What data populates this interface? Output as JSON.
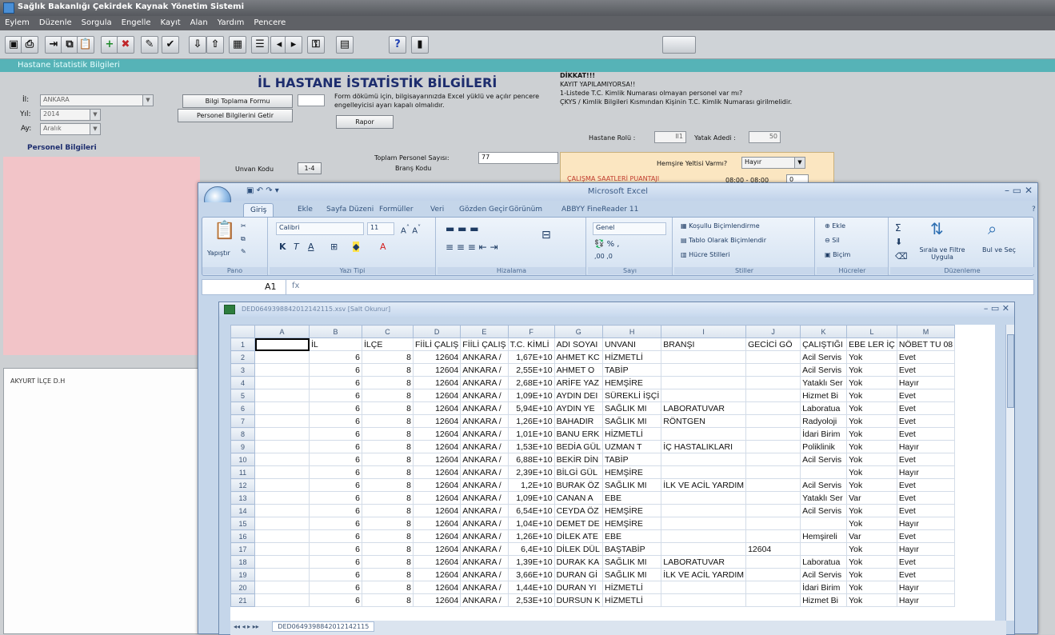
{
  "window": {
    "title": "Sağlık Bakanlığı Çekirdek Kaynak Yönetim Sistemi"
  },
  "menu": [
    "Eylem",
    "Düzenle",
    "Sorgula",
    "Engelle",
    "Kayıt",
    "Alan",
    "Yardım",
    "Pencere"
  ],
  "toolbar_icons": [
    "save-icon",
    "print-icon",
    "exit-icon",
    "copy-icon",
    "paste-icon",
    "insert-record-icon",
    "delete-record-icon",
    "edit-icon",
    "check-icon",
    "import-icon",
    "export-icon",
    "chart-icon",
    "list-icon",
    "previous-icon",
    "next-icon",
    "key-icon",
    "report-icon",
    "help-icon",
    "door-icon"
  ],
  "form": {
    "header": "Hastane İstatistik Bilgileri",
    "title": "İL HASTANE İSTATİSTİK BİLGİLERİ",
    "il_label": "İl:",
    "il_value": "ANKARA",
    "yil_label": "Yıl:",
    "yil_value": "2014",
    "ay_label": "Ay:",
    "ay_value": "Aralık",
    "btn_bilgi": "Bilgi Toplama Formu",
    "btn_personel": "Personel Bilgilerini Getir",
    "btn_rapor": "Rapor",
    "note": "Form dökümü için, bilgisayarınızda Excel yüklü ve açılır pencere engelleyicisi ayarı kapalı olmalıdır.",
    "dikkat_title": "DİKKAT!!!",
    "dikkat_lines": [
      "KAYIT YAPILAMIYORSA!!",
      "1-Listede T.C. Kimlik Numarası olmayan personel var mı?",
      "ÇKYS / Kimlik Bilgileri Kısmından Kişinin T.C. Kimlik Numarası girilmelidir."
    ],
    "hastane_rolu_label": "Hastane Rolü :",
    "hastane_rolu_value": "II1",
    "yatak_label": "Yatak Adedi :",
    "yatak_value": "50",
    "personel_section": "Personel Bilgileri",
    "unvan_label": "Unvan Kodu",
    "unvan_btn": "1-4",
    "toplam_label": "Toplam Personel Sayısı:",
    "toplam_value": "77",
    "brans_label": "Branş Kodu",
    "hemsire_label": "Hemşire Yeltisi Varmı?",
    "hemsire_value": "Hayır",
    "calisma_label": "ÇALIŞMA SAATLERİ PUANTAJI",
    "calisma_value": "08:00 - 08:00",
    "calisma_num": "0",
    "list_item": "AKYURT İLÇE D.H"
  },
  "excel": {
    "title": "Microsoft Excel",
    "tabs": [
      "Giriş",
      "Ekle",
      "Sayfa Düzeni",
      "Formüller",
      "Veri",
      "Gözden Geçir",
      "Görünüm",
      "ABBYY FineReader 11"
    ],
    "ribbon": {
      "pano": "Pano",
      "yapistir": "Yapıştır",
      "font_name": "Calibri",
      "font_size": "11",
      "yazi_tipi": "Yazı Tipi",
      "hizalama": "Hizalama",
      "genel": "Genel",
      "sayi": "Sayı",
      "kosullu": "Koşullu Biçimlendirme",
      "tablo": "Tablo Olarak Biçimlendir",
      "hucre_stil": "Hücre Stilleri",
      "stiller": "Stiller",
      "ekle": "Ekle",
      "sil": "Sil",
      "bicim": "Biçim",
      "hucreler": "Hücreler",
      "sirala": "Sırala ve Filtre Uygula",
      "bul": "Bul ve Seç",
      "duzenleme": "Düzenleme"
    },
    "name_box": "A1",
    "fx": "fx",
    "workbook_title": "DED0649398842012142115.xsv [Salt Okunur]",
    "sheet_tab": "DED0649398842012142115",
    "columns": [
      "A",
      "B",
      "C",
      "D",
      "E",
      "F",
      "G",
      "H",
      "I",
      "J",
      "K",
      "L",
      "M"
    ],
    "rows": [
      [
        "1",
        "",
        "İL",
        "İLÇE",
        "FİİLİ ÇALIŞ",
        "FİİLİ ÇALIŞ",
        "T.C. KİMLİ",
        "ADI SOYAI",
        "UNVANI",
        "BRANŞI",
        "GECİCİ GÖ",
        "ÇALIŞTIĞI",
        "EBE LER İÇ",
        "NÖBET TU 08"
      ],
      [
        "2",
        "",
        "6",
        "8",
        "12604",
        "ANKARA /",
        "1,67E+10",
        "AHMET KC",
        "HİZMETLİ",
        "",
        "",
        "Acil Servis",
        "Yok",
        "Evet"
      ],
      [
        "3",
        "",
        "6",
        "8",
        "12604",
        "ANKARA /",
        "2,55E+10",
        "AHMET O",
        "TABİP",
        "",
        "",
        "Acil Servis",
        "Yok",
        "Evet"
      ],
      [
        "4",
        "",
        "6",
        "8",
        "12604",
        "ANKARA /",
        "2,68E+10",
        "ARİFE YAZ",
        "HEMŞİRE",
        "",
        "",
        "Yataklı Ser",
        "Yok",
        "Hayır"
      ],
      [
        "5",
        "",
        "6",
        "8",
        "12604",
        "ANKARA /",
        "1,09E+10",
        "AYDIN DEI",
        "SÜREKLİ İŞÇİ",
        "",
        "",
        "Hizmet Bi",
        "Yok",
        "Evet"
      ],
      [
        "6",
        "",
        "6",
        "8",
        "12604",
        "ANKARA /",
        "5,94E+10",
        "AYDIN YE",
        "SAĞLIK MI",
        "LABORATUVAR",
        "",
        "Laboratua",
        "Yok",
        "Evet"
      ],
      [
        "7",
        "",
        "6",
        "8",
        "12604",
        "ANKARA /",
        "1,26E+10",
        "BAHADIR",
        "SAĞLIK MI",
        "RÖNTGEN",
        "",
        "Radyoloji",
        "Yok",
        "Evet"
      ],
      [
        "8",
        "",
        "6",
        "8",
        "12604",
        "ANKARA /",
        "1,01E+10",
        "BANU ERK",
        "HİZMETLİ",
        "",
        "",
        "İdari Birim",
        "Yok",
        "Evet"
      ],
      [
        "9",
        "",
        "6",
        "8",
        "12604",
        "ANKARA /",
        "1,53E+10",
        "BEDİA GÜL",
        "UZMAN T",
        "İÇ HASTALIKLARI",
        "",
        "Poliklinik",
        "Yok",
        "Hayır"
      ],
      [
        "10",
        "",
        "6",
        "8",
        "12604",
        "ANKARA /",
        "6,88E+10",
        "BEKİR DİN",
        "TABİP",
        "",
        "",
        "Acil Servis",
        "Yok",
        "Evet"
      ],
      [
        "11",
        "",
        "6",
        "8",
        "12604",
        "ANKARA /",
        "2,39E+10",
        "BİLGİ GÜL",
        "HEMŞİRE",
        "",
        "",
        "",
        "Yok",
        "Hayır"
      ],
      [
        "12",
        "",
        "6",
        "8",
        "12604",
        "ANKARA /",
        "1,2E+10",
        "BURAK ÖZ",
        "SAĞLIK MI",
        "İLK VE ACİL YARDIM",
        "",
        "Acil Servis",
        "Yok",
        "Evet"
      ],
      [
        "13",
        "",
        "6",
        "8",
        "12604",
        "ANKARA /",
        "1,09E+10",
        "CANAN A",
        "EBE",
        "",
        "",
        "Yataklı Ser",
        "Var",
        "Evet"
      ],
      [
        "14",
        "",
        "6",
        "8",
        "12604",
        "ANKARA /",
        "6,54E+10",
        "CEYDA ÖZ",
        "HEMŞİRE",
        "",
        "",
        "Acil Servis",
        "Yok",
        "Evet"
      ],
      [
        "15",
        "",
        "6",
        "8",
        "12604",
        "ANKARA /",
        "1,04E+10",
        "DEMET DE",
        "HEMŞİRE",
        "",
        "",
        "",
        "Yok",
        "Hayır"
      ],
      [
        "16",
        "",
        "6",
        "8",
        "12604",
        "ANKARA /",
        "1,26E+10",
        "DİLEK ATE",
        "EBE",
        "",
        "",
        "Hemşireli",
        "Var",
        "Evet"
      ],
      [
        "17",
        "",
        "6",
        "8",
        "12604",
        "ANKARA /",
        "6,4E+10",
        "DİLEK DÜL",
        "BAŞTABİP",
        "",
        "12604",
        "",
        "Yok",
        "Hayır"
      ],
      [
        "18",
        "",
        "6",
        "8",
        "12604",
        "ANKARA /",
        "1,39E+10",
        "DURAK KA",
        "SAĞLIK MI",
        "LABORATUVAR",
        "",
        "Laboratua",
        "Yok",
        "Evet"
      ],
      [
        "19",
        "",
        "6",
        "8",
        "12604",
        "ANKARA /",
        "3,66E+10",
        "DURAN Gİ",
        "SAĞLIK MI",
        "İLK VE ACİL YARDIM",
        "",
        "Acil Servis",
        "Yok",
        "Evet"
      ],
      [
        "20",
        "",
        "6",
        "8",
        "12604",
        "ANKARA /",
        "1,44E+10",
        "DURAN YI",
        "HİZMETLİ",
        "",
        "",
        "İdari Birim",
        "Yok",
        "Hayır"
      ],
      [
        "21",
        "",
        "6",
        "8",
        "12604",
        "ANKARA /",
        "2,53E+10",
        "DURSUN K",
        "HİZMETLİ",
        "",
        "",
        "Hizmet Bi",
        "Yok",
        "Hayır"
      ]
    ]
  }
}
